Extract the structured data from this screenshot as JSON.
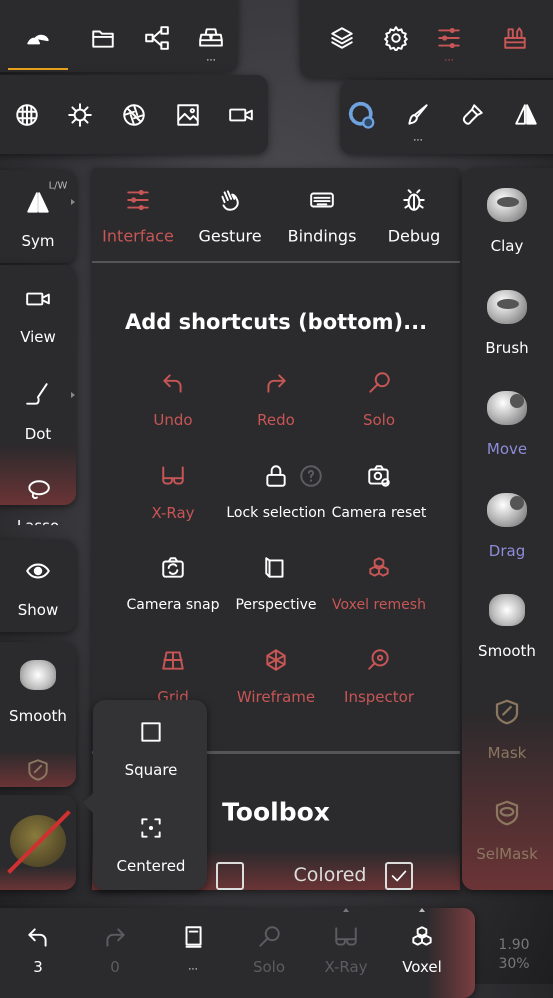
{
  "top_left": {
    "icons": [
      "scene-icon",
      "folder-icon",
      "share-graph-icon",
      "gold-bars-icon"
    ],
    "more": "..."
  },
  "second_left": {
    "icons": [
      "matcap-icon",
      "light-icon",
      "aperture-icon",
      "image-icon",
      "camera-icon"
    ]
  },
  "top_right": {
    "icons": [
      "layers-icon",
      "gear-icon",
      "sliders-icon",
      "toolbox-icon"
    ],
    "more": "..."
  },
  "second_right": {
    "icons": [
      "voxel-dots-icon",
      "brush-icon",
      "paint-icon",
      "symmetry-icon"
    ],
    "more": "..."
  },
  "left_tools": [
    {
      "label": "Sym",
      "badge": "L/W"
    },
    {
      "label": "View"
    },
    {
      "label": "Dot"
    },
    {
      "label": "Lasso"
    },
    {
      "label": "Show"
    },
    {
      "label": "Smooth"
    }
  ],
  "tabs": [
    {
      "label": "Interface",
      "active": true
    },
    {
      "label": "Gesture"
    },
    {
      "label": "Bindings"
    },
    {
      "label": "Debug"
    }
  ],
  "shortcuts_title": "Add shortcuts (bottom)...",
  "shortcuts": [
    {
      "label": "Undo",
      "enabled": true,
      "icon": "undo-icon"
    },
    {
      "label": "Redo",
      "enabled": true,
      "icon": "redo-icon"
    },
    {
      "label": "Solo",
      "enabled": true,
      "icon": "search-icon"
    },
    {
      "label": "X-Ray",
      "enabled": true,
      "icon": "glasses-icon"
    },
    {
      "label": "Lock selection",
      "enabled": false,
      "icon": "lock-icon"
    },
    {
      "label": "Camera reset",
      "enabled": false,
      "icon": "camera-reset-icon"
    },
    {
      "label": "Camera snap",
      "enabled": false,
      "icon": "camera-snap-icon"
    },
    {
      "label": "Perspective",
      "enabled": false,
      "icon": "cube-icon"
    },
    {
      "label": "Voxel remesh",
      "enabled": true,
      "icon": "voxel-icon"
    },
    {
      "label": "Grid",
      "enabled": true,
      "icon": "grid-icon"
    },
    {
      "label": "Wireframe",
      "enabled": true,
      "icon": "wireframe-icon"
    },
    {
      "label": "Inspector",
      "enabled": true,
      "icon": "inspector-icon"
    }
  ],
  "toolbox": {
    "title": "Toolbox",
    "colored_label": "Colored",
    "first_checked": false,
    "colored_checked": true
  },
  "popover": [
    {
      "label": "Square"
    },
    {
      "label": "Centered"
    }
  ],
  "right_tools": [
    {
      "label": "Clay"
    },
    {
      "label": "Brush"
    },
    {
      "label": "Move",
      "color": "#8d8cd8"
    },
    {
      "label": "Drag",
      "color": "#8d8cd8"
    },
    {
      "label": "Smooth"
    },
    {
      "label": "Mask",
      "color": "#8b7760"
    },
    {
      "label": "SelMask",
      "color": "#8b7760"
    }
  ],
  "bottom": [
    {
      "label": "3",
      "icon": "undo-icon"
    },
    {
      "label": "0",
      "icon": "redo-icon",
      "dim": true
    },
    {
      "label": "...",
      "icon": "book-icon"
    },
    {
      "label": "Solo",
      "icon": "search-icon",
      "dim": true
    },
    {
      "label": "X-Ray",
      "icon": "glasses-icon",
      "dim": true
    },
    {
      "label": "Voxel",
      "icon": "voxel-icon"
    }
  ],
  "stats": {
    "size": "1.90",
    "percent": "30%"
  },
  "colors": {
    "accent": "#c75656",
    "active_underline": "#e8a020",
    "panel": "#2b2a2c"
  }
}
